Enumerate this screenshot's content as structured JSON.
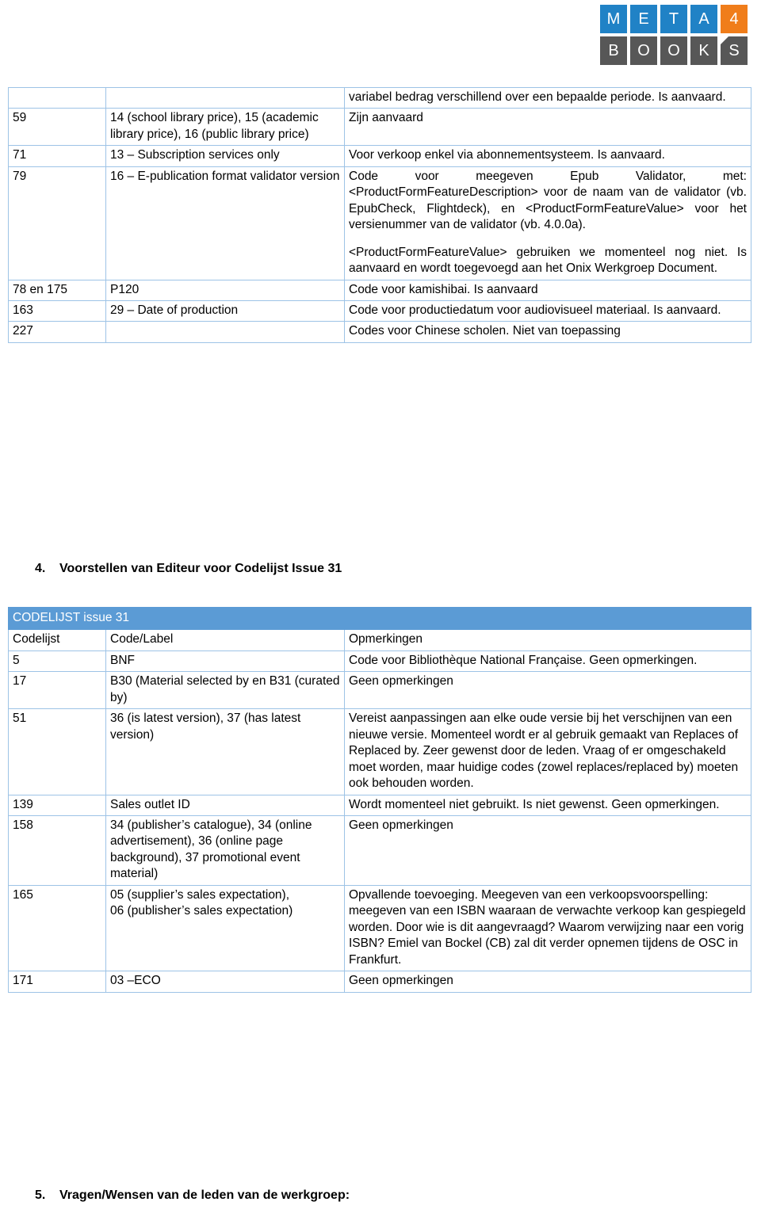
{
  "logo": {
    "name": "meta4books-logo",
    "top_letters": [
      "M",
      "E",
      "T",
      "A",
      "4"
    ],
    "bottom_letters": [
      "B",
      "O",
      "O",
      "K",
      "S"
    ],
    "colors": {
      "blue": "#2082C6",
      "gray": "#575757",
      "orange": "#F07D1A"
    }
  },
  "table_one": {
    "rows": [
      {
        "codelijst": "",
        "code_label": "",
        "opmerkingen": "variabel bedrag verschillend over een bepaalde periode. Is aanvaard."
      },
      {
        "codelijst": "59",
        "code_label": "14 (school library price), 15 (academic library price), 16 (public library price)",
        "opmerkingen": "Zijn aanvaard"
      },
      {
        "codelijst": "71",
        "code_label": "13 – Subscription services only",
        "opmerkingen": "Voor verkoop enkel via abonnementsysteem. Is aanvaard."
      },
      {
        "codelijst": "79",
        "code_label": "16 – E-publication format validator version",
        "opmerkingen": "Code voor meegeven Epub Validator, met: <ProductFormFeatureDescription> voor de naam van de validator (vb. EpubCheck, Flightdeck), en <ProductFormFeatureValue> voor het versienummer van de validator (vb. 4.0.0a).",
        "opmerkingen2": "<ProductFormFeatureValue> gebruiken we momenteel nog niet. Is aanvaard en wordt toegevoegd aan het Onix Werkgroep Document."
      },
      {
        "codelijst": "78 en 175",
        "code_label": "P120",
        "opmerkingen": "Code voor kamishibai. Is aanvaard"
      },
      {
        "codelijst": "163",
        "code_label": "29 – Date of production",
        "opmerkingen": "Code voor productiedatum voor audiovisueel materiaal. Is aanvaard."
      },
      {
        "codelijst": "227",
        "code_label": "",
        "opmerkingen": "Codes voor Chinese scholen. Niet van toepassing"
      }
    ]
  },
  "heading_4": {
    "number": "4.",
    "text": "Voorstellen van Editeur voor Codelijst Issue 31"
  },
  "table_two": {
    "banner": "CODELIJST issue 31",
    "headers": {
      "codelijst": "Codelijst",
      "code_label": "Code/Label",
      "opmerkingen": "Opmerkingen"
    },
    "rows": [
      {
        "codelijst": "5",
        "code_label": "BNF",
        "opmerkingen": "Code voor Bibliothèque National Française. Geen opmerkingen."
      },
      {
        "codelijst": "17",
        "code_label": "B30 (Material selected by en B31 (curated by)",
        "opmerkingen": "Geen opmerkingen"
      },
      {
        "codelijst": "51",
        "code_label": "36 (is latest version), 37 (has latest version)",
        "opmerkingen": "Vereist aanpassingen aan elke oude versie bij het verschijnen van een nieuwe versie. Momenteel wordt er al gebruik gemaakt van Replaces of Replaced by. Zeer gewenst door de leden. Vraag of er omgeschakeld moet worden, maar huidige codes (zowel replaces/replaced by) moeten ook behouden worden."
      },
      {
        "codelijst": "139",
        "code_label": "Sales outlet ID",
        "opmerkingen": "Wordt momenteel niet gebruikt. Is niet gewenst. Geen opmerkingen."
      },
      {
        "codelijst": "158",
        "code_label": "34 (publisher’s catalogue), 34 (online advertisement), 36 (online page background), 37 promotional event material)",
        "opmerkingen": "Geen opmerkingen"
      },
      {
        "codelijst": "165",
        "code_label": "05 (supplier’s sales expectation),",
        "code_label2": "06 (publisher’s sales expectation)",
        "opmerkingen": "Opvallende toevoeging. Meegeven van een verkoopsvoorspelling: meegeven van een ISBN waaraan de verwachte verkoop kan gespiegeld worden. Door wie is dit aangevraagd? Waarom verwijzing naar een vorig ISBN? Emiel van Bockel (CB) zal dit verder opnemen tijdens de OSC in Frankfurt."
      },
      {
        "codelijst": "171",
        "code_label": "03 –ECO",
        "opmerkingen": "Geen opmerkingen"
      }
    ]
  },
  "heading_5": {
    "number": "5.",
    "text": "Vragen/Wensen van de leden van de werkgroep:"
  }
}
